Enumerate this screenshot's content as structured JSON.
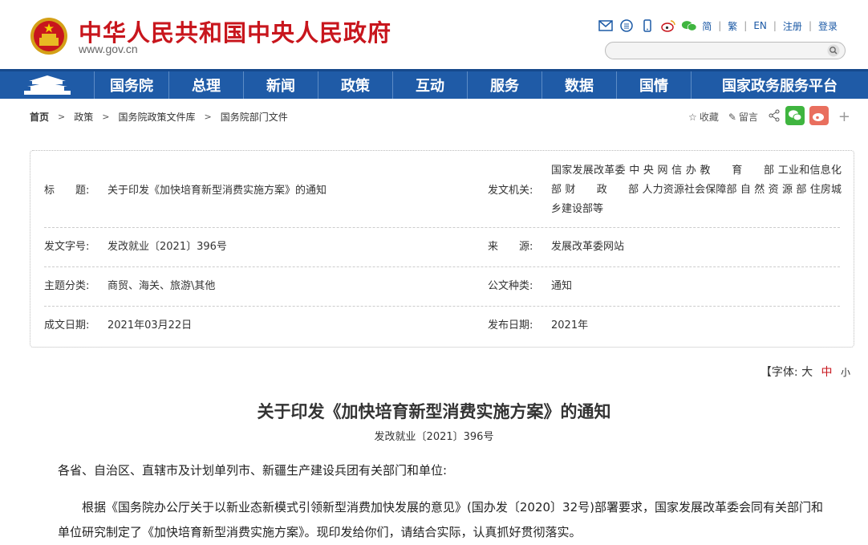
{
  "header": {
    "site_name": "中华人民共和国中央人民政府",
    "site_url": "www.gov.cn",
    "lang": {
      "simplified": "简",
      "traditional": "繁",
      "english": "EN"
    },
    "register": "注册",
    "login": "登录",
    "colors": {
      "brand_red": "#c8161d",
      "nav_blue": "#1f5ba7"
    }
  },
  "nav": {
    "items": [
      "国务院",
      "总理",
      "新闻",
      "政策",
      "互动",
      "服务",
      "数据",
      "国情",
      "国家政务服务平台"
    ]
  },
  "breadcrumb": {
    "items": [
      "首页",
      "政策",
      "国务院政策文件库",
      "国务院部门文件"
    ]
  },
  "actions": {
    "favorite": "收藏",
    "comment": "留言"
  },
  "info": {
    "title_label": "标　　题:",
    "title_value": "关于印发《加快培育新型消费实施方案》的通知",
    "issuer_label": "发文机关:",
    "issuer_value": "国家发展改革委 中 央 网 信 办 教　　育　　部 工业和信息化部 财　　政　　部 人力资源社会保障部 自 然 资 源 部 住房城乡建设部等",
    "doc_no_label": "发文字号:",
    "doc_no_value": "发改就业〔2021〕396号",
    "source_label": "来　　源:",
    "source_value": "发展改革委网站",
    "topic_label": "主题分类:",
    "topic_value": "商贸、海关、旅游\\其他",
    "type_label": "公文种类:",
    "type_value": "通知",
    "created_label": "成文日期:",
    "created_value": "2021年03月22日",
    "published_label": "发布日期:",
    "published_value": "2021年"
  },
  "fontsize": {
    "prefix": "【字体:",
    "large": "大",
    "medium": "中",
    "small": "小"
  },
  "article": {
    "title": "关于印发《加快培育新型消费实施方案》的通知",
    "doc_no": "发改就业〔2021〕396号",
    "salutation": "各省、自治区、直辖市及计划单列市、新疆生产建设兵团有关部门和单位:",
    "body_1": "　　根据《国务院办公厅关于以新业态新模式引领新型消费加快发展的意见》(国办发〔2020〕32号)部署要求，国家发展改革委会同有关部门和单位研究制定了《加快培育新型消费实施方案》。现印发给你们，请结合实际，认真抓好贯彻落实。"
  }
}
